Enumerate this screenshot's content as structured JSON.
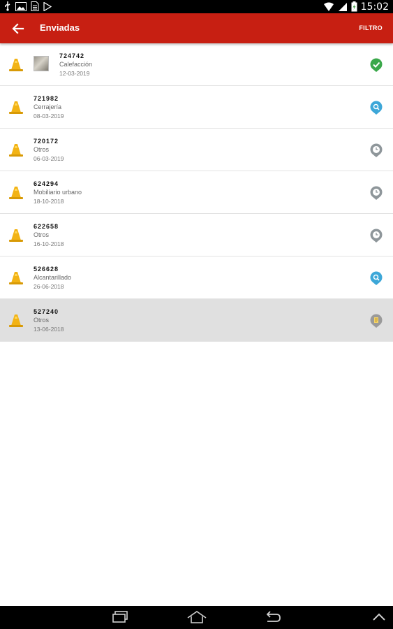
{
  "statusbar": {
    "time": "15:02",
    "icons": [
      "usb-icon",
      "image-icon",
      "document-icon",
      "play-store-icon",
      "wifi-icon",
      "signal-icon",
      "battery-charging-icon"
    ]
  },
  "appbar": {
    "title": "Enviadas",
    "filter_label": "FILTRO",
    "background": "#c71f12"
  },
  "list": [
    {
      "id": "724742",
      "category": "Calefacción",
      "date": "12-03-2019",
      "status": "resolved",
      "has_thumbnail": true,
      "selected": false
    },
    {
      "id": "721982",
      "category": "Cerrajería",
      "date": "08-03-2019",
      "status": "in-progress",
      "has_thumbnail": false,
      "selected": false
    },
    {
      "id": "720172",
      "category": "Otros",
      "date": "06-03-2019",
      "status": "pending",
      "has_thumbnail": false,
      "selected": false
    },
    {
      "id": "624294",
      "category": "Mobiliario urbano",
      "date": "18-10-2018",
      "status": "pending",
      "has_thumbnail": false,
      "selected": false
    },
    {
      "id": "622658",
      "category": "Otros",
      "date": "16-10-2018",
      "status": "pending",
      "has_thumbnail": false,
      "selected": false
    },
    {
      "id": "526628",
      "category": "Alcantarillado",
      "date": "26-06-2018",
      "status": "in-progress",
      "has_thumbnail": false,
      "selected": false
    },
    {
      "id": "527240",
      "category": "Otros",
      "date": "13-06-2018",
      "status": "rejected",
      "has_thumbnail": false,
      "selected": true
    }
  ],
  "colors": {
    "resolved": "#3aa84a",
    "in-progress": "#3da7d8",
    "pending": "#8e969a",
    "rejected": "#9a9a9a",
    "cone": "#f2b315"
  },
  "navbar": {
    "buttons": [
      "recent-apps-icon",
      "home-icon",
      "back-icon",
      "chevron-up-icon"
    ]
  }
}
